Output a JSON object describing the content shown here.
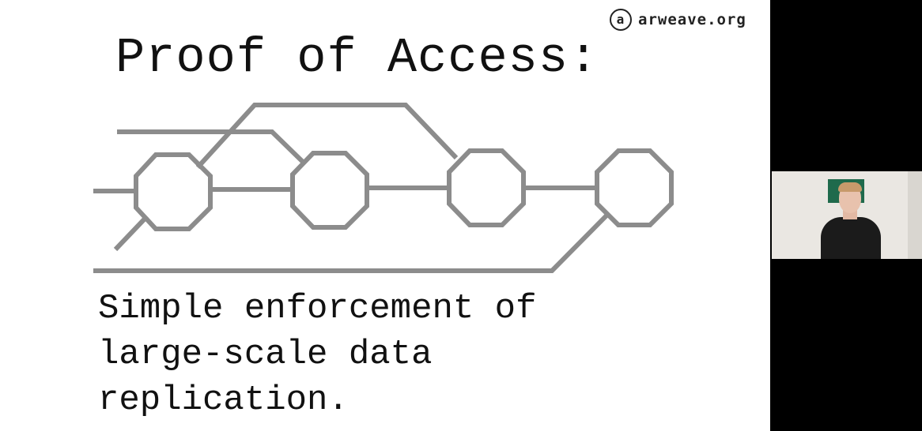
{
  "slide": {
    "brand": {
      "icon": "at-sign-icon",
      "icon_glyph": "a",
      "text": "arweave.org"
    },
    "title": "Proof of Access:",
    "caption_lines": [
      "Simple enforcement of",
      "large-scale data",
      "replication."
    ],
    "diagram": {
      "block_count": 4,
      "line_color": "#8c8c8c"
    }
  },
  "webcam": {
    "presence": "presenter-video-feed"
  },
  "colors": {
    "slide_bg": "#ffffff",
    "frame_bg": "#000000",
    "text": "#111111"
  }
}
